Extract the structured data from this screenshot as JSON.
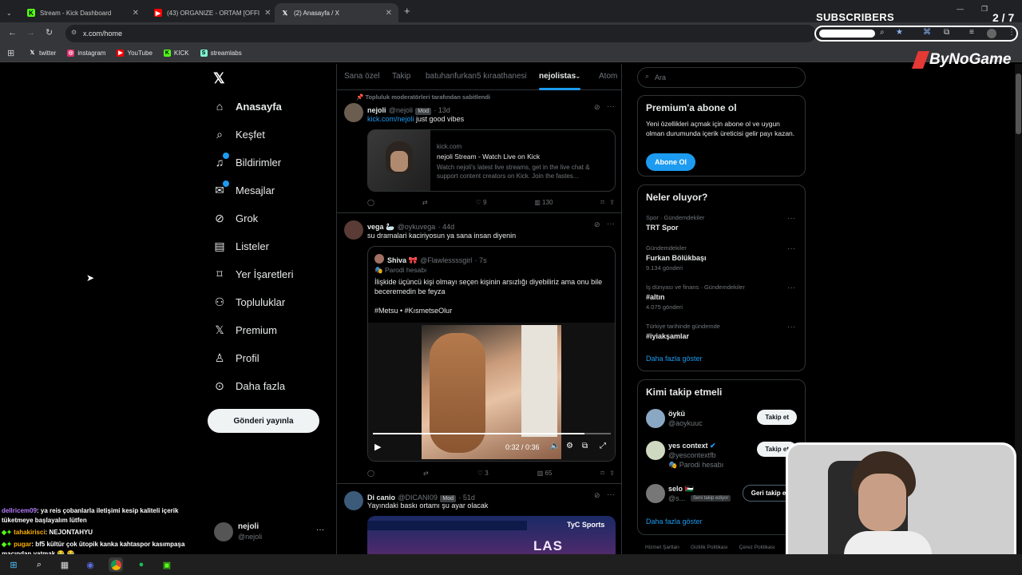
{
  "tabs": [
    {
      "label": "Stream - Kick Dashboard"
    },
    {
      "label": "(43) ORGANIZE - ORTAM [OFFI"
    },
    {
      "label": "(2) Anasayfa / X"
    }
  ],
  "address": "x.com/home",
  "bookmarks": [
    {
      "label": "twitter"
    },
    {
      "label": "instagram"
    },
    {
      "label": "YouTube"
    },
    {
      "label": "KICK"
    },
    {
      "label": "streamlabs"
    }
  ],
  "overlay": {
    "subscribers_label": "SUBSCRIBERS",
    "subscribers_count": "2 / 7",
    "brand": "ByNoGame"
  },
  "nav": {
    "items": [
      {
        "label": "Anasayfa"
      },
      {
        "label": "Keşfet"
      },
      {
        "label": "Bildirimler"
      },
      {
        "label": "Mesajlar"
      },
      {
        "label": "Grok"
      },
      {
        "label": "Listeler"
      },
      {
        "label": "Yer İşaretleri"
      },
      {
        "label": "Topluluklar"
      },
      {
        "label": "Premium"
      },
      {
        "label": "Profil"
      },
      {
        "label": "Daha fazla"
      }
    ],
    "post_button": "Gönderi yayınla",
    "account_name": "nejoli",
    "account_handle": "@nejoli"
  },
  "feed": {
    "tabs": [
      "Sana özel",
      "Takip",
      "batuhanfurkan5 kıraathanesi",
      "nejolistas",
      "Atom"
    ],
    "pinned_label": "Topluluk moderatörleri tarafından sabitlendi",
    "post1": {
      "name": "nejoli",
      "handle": "@nejoli",
      "badge": "Mod",
      "time": "· 13d",
      "link": "kick.com/nejoli",
      "text": " just good vibes",
      "card_domain": "kick.com",
      "card_title": "nejoli Stream - Watch Live on Kick",
      "card_desc": "Watch nejoli's latest live streams, get in the live chat & support content creators on Kick. Join the fastes...",
      "likes": "9",
      "views": "130"
    },
    "post2": {
      "name": "vega 🦢",
      "handle": "@oykuvega",
      "time": "· 44d",
      "text": "su dramalari kaciriyosun ya sana insan diyenin",
      "quote_name": "Shiva 🎀",
      "quote_handle": "@Flawlessssgirl",
      "quote_time": "· 7s",
      "quote_label": "Parodi hesabı",
      "quote_text": "İlişkide üçüncü kişi olmayı seçen kişinin arsızlığı diyebiliriz ama onu bile beceremedin be feyza",
      "quote_tags": "#Metsu • #KısmetseOlur",
      "video_time": "0:32 / 0:36",
      "likes": "3",
      "views": "65"
    },
    "post3": {
      "name": "Di canio",
      "handle": "@DICANI09",
      "badge": "Mod",
      "time": "· 51d",
      "text": "Yayındaki baskı ortamı şu ayar olacak",
      "media_brand": "TyC Sports",
      "media_banner": "LAS HERAS"
    }
  },
  "search": {
    "placeholder": "Ara"
  },
  "premium": {
    "title": "Premium'a abone ol",
    "text": "Yeni özellikleri açmak için abone ol ve uygun olman durumunda içerik üreticisi gelir payı kazan.",
    "button": "Abone Ol"
  },
  "trends": {
    "title": "Neler oluyor?",
    "items": [
      {
        "category": "Spor · Gündemdekiler",
        "title": "TRT Spor",
        "count": ""
      },
      {
        "category": "Gündemdekiler",
        "title": "Furkan Bölükbaşı",
        "count": "9.134 gönderi"
      },
      {
        "category": "İş dünyası ve finans · Gündemdekiler",
        "title": "#altın",
        "count": "4.075 gönderi"
      },
      {
        "category": "Türkiye tarihinde gündemde",
        "title": "#iyiakşamlar",
        "count": ""
      }
    ],
    "more": "Daha fazla göster"
  },
  "who_to_follow": {
    "title": "Kimi takip etmeli",
    "items": [
      {
        "name": "öykü",
        "handle": "@aoykuuc",
        "extra": "",
        "button": "Takip et"
      },
      {
        "name": "yes context",
        "handle": "@yescontextfb",
        "extra": "Parodi hesabı",
        "button": "Takip et"
      },
      {
        "name": "selo 🇵🇸",
        "handle": "@s...",
        "extra": "Seni takip ediyor",
        "button": "Geri takip et"
      }
    ],
    "more": "Daha fazla göster"
  },
  "footer": {
    "links": [
      "Hizmet Şartları",
      "Gizlilik Politikası",
      "Çerez Politikası"
    ]
  },
  "chat": [
    {
      "user": "dellricem09",
      "text": ": ya reis çobanlarla iletişimi kesip kaliteli içerik tüketmeye başlayalım lütfen",
      "color": "#b57cff"
    },
    {
      "user": "tahakirisci",
      "text": ": NEJONTAHYU",
      "color": "#ffb000"
    },
    {
      "user": "pugar",
      "text": ": bf5 kültür çok ütopik kanka kahtaspor kasımpaşa maçından yatmak 😂 😂",
      "color": "#ffb000"
    }
  ],
  "colors": {
    "x_blue": "#1d9bf0",
    "kick_green": "#53fc18",
    "bg": "#000000",
    "border": "#2f3336"
  }
}
